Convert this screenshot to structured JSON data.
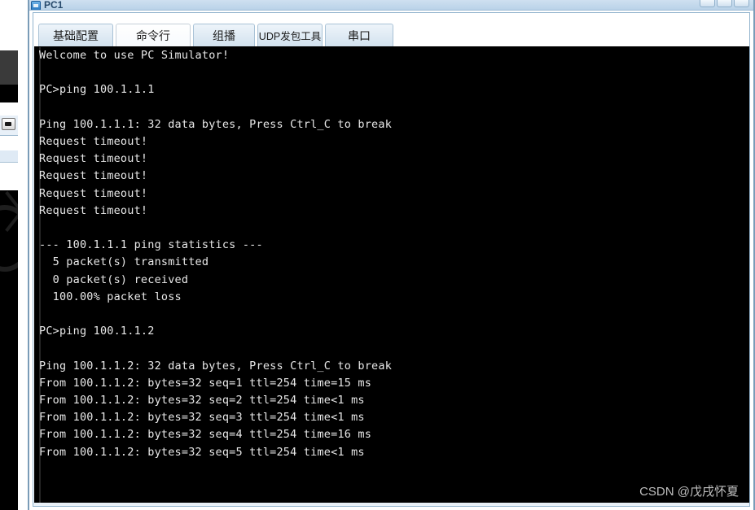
{
  "window": {
    "title": "PC1",
    "controls": [
      "minimize-button",
      "maximize-button",
      "close-button"
    ]
  },
  "tabs": [
    {
      "label": "基础配置",
      "name": "tab-basic-config",
      "selected": false
    },
    {
      "label": "命令行",
      "name": "tab-command-line",
      "selected": true
    },
    {
      "label": "组播",
      "name": "tab-multicast",
      "selected": false
    },
    {
      "label": "UDP发包工具",
      "name": "tab-udp-tool",
      "selected": false
    },
    {
      "label": "串口",
      "name": "tab-serial-port",
      "selected": false
    }
  ],
  "terminal": {
    "background_color": "#000000",
    "text_color": "#e8e8e8",
    "content": "Welcome to use PC Simulator!\n\nPC>ping 100.1.1.1\n\nPing 100.1.1.1: 32 data bytes, Press Ctrl_C to break\nRequest timeout!\nRequest timeout!\nRequest timeout!\nRequest timeout!\nRequest timeout!\n\n--- 100.1.1.1 ping statistics ---\n  5 packet(s) transmitted\n  0 packet(s) received\n  100.00% packet loss\n\nPC>ping 100.1.1.2\n\nPing 100.1.1.2: 32 data bytes, Press Ctrl_C to break\nFrom 100.1.1.2: bytes=32 seq=1 ttl=254 time=15 ms\nFrom 100.1.1.2: bytes=32 seq=2 ttl=254 time<1 ms\nFrom 100.1.1.2: bytes=32 seq=3 ttl=254 time<1 ms\nFrom 100.1.1.2: bytes=32 seq=4 ttl=254 time=16 ms\nFrom 100.1.1.2: bytes=32 seq=5 ttl=254 time<1 ms",
    "lines": [
      "Welcome to use PC Simulator!",
      "",
      "PC>ping 100.1.1.1",
      "",
      "Ping 100.1.1.1: 32 data bytes, Press Ctrl_C to break",
      "Request timeout!",
      "Request timeout!",
      "Request timeout!",
      "Request timeout!",
      "Request timeout!",
      "",
      "--- 100.1.1.1 ping statistics ---",
      "  5 packet(s) transmitted",
      "  0 packet(s) received",
      "  100.00% packet loss",
      "",
      "PC>ping 100.1.1.2",
      "",
      "Ping 100.1.1.2: 32 data bytes, Press Ctrl_C to break",
      "From 100.1.1.2: bytes=32 seq=1 ttl=254 time=15 ms",
      "From 100.1.1.2: bytes=32 seq=2 ttl=254 time<1 ms",
      "From 100.1.1.2: bytes=32 seq=3 ttl=254 time<1 ms",
      "From 100.1.1.2: bytes=32 seq=4 ttl=254 time=16 ms",
      "From 100.1.1.2: bytes=32 seq=5 ttl=254 time<1 ms"
    ]
  },
  "watermark": {
    "text": "CSDN @戊戌怀夏",
    "color": "#d9d9d9"
  }
}
